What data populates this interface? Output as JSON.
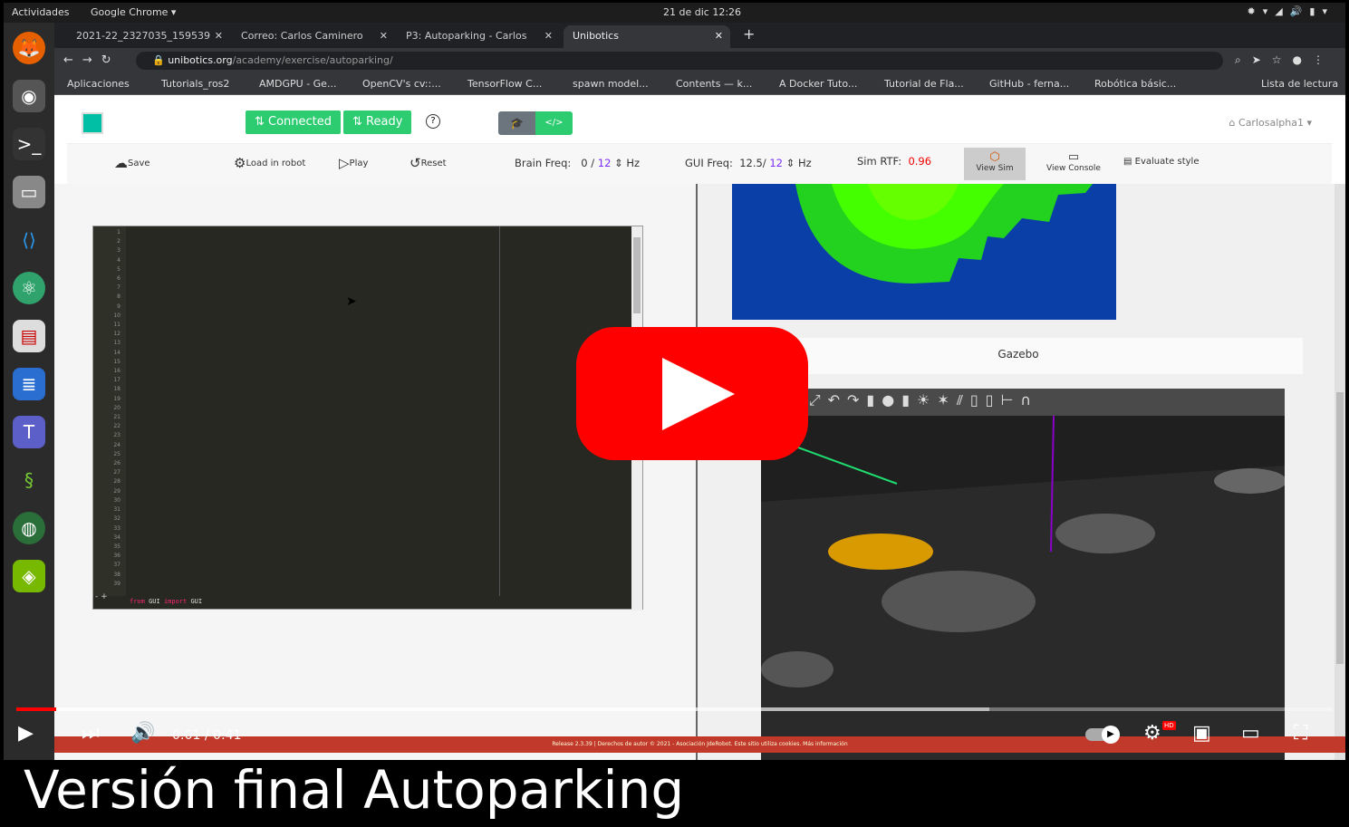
{
  "topbar": {
    "activities": "Actividades",
    "app": "Google Chrome ▾",
    "clock": "21 de dic  12:26"
  },
  "tabs": [
    {
      "label": "2021-22_2327035_159539"
    },
    {
      "label": "Correo: Carlos Caminero"
    },
    {
      "label": "P3: Autoparking - Carlos"
    },
    {
      "label": "Unibotics"
    }
  ],
  "omnibar": {
    "host": "unibotics.org",
    "path": "/academy/exercise/autoparking/"
  },
  "bookmarks": [
    "Aplicaciones",
    "Tutorials_ros2",
    "AMDGPU - Ge...",
    "OpenCV's cv::...",
    "TensorFlow C...",
    "spawn model...",
    "Contents — k...",
    "A Docker Tuto...",
    "Tutorial de Fla...",
    "GitHub - ferna...",
    "Robótica básic...",
    "Lista de lectura"
  ],
  "page": {
    "connected": "⇅ Connected",
    "ready": "⇅ Ready",
    "help": "?",
    "user": "Carlosalpha1",
    "toolbar": {
      "save": "Save",
      "load": "Load in robot",
      "play": "Play",
      "reset": "Reset",
      "brain_freq_label": "Brain Freq:",
      "brain_freq_value": "0",
      "brain_freq_target": "12",
      "hz": "Hz",
      "gui_freq_label": "GUI Freq:",
      "gui_freq_value": "12.5/",
      "gui_freq_target": "12",
      "sim_rtf_label": "Sim RTF:",
      "sim_rtf_value": "0.96",
      "view_sim": "View Sim",
      "view_console": "View Console",
      "evaluate": "Evaluate style"
    },
    "code_line": {
      "kw1": "from",
      "mod": "GUI",
      "kw2": "import",
      "name": "GUI"
    },
    "gazebo_title": "Gazebo",
    "footer": "Release 2.3.39 | Derechos de autor © 2021 - Asociación JdeRobot. Este sitio utiliza cookies. Más información"
  },
  "video": {
    "time": "0:01 / 0:41",
    "progress": 0.03,
    "buffered": 0.74,
    "hd": "HD",
    "caption": "Versión final Autoparking"
  }
}
